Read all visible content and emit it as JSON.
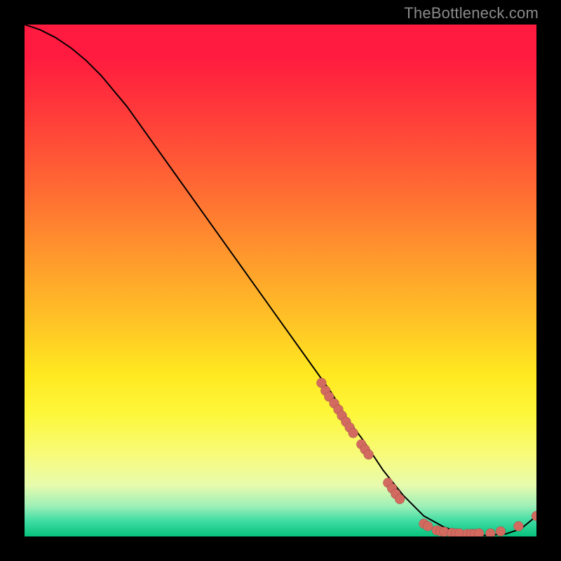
{
  "watermark": "TheBottleneck.com",
  "colors": {
    "point": "#d36a60",
    "curve": "#000000",
    "background": "#000000"
  },
  "chart_data": {
    "type": "line",
    "title": "",
    "xlabel": "",
    "ylabel": "",
    "xlim": [
      0,
      100
    ],
    "ylim": [
      0,
      100
    ],
    "grid": false,
    "legend": false,
    "curve": {
      "x": [
        0,
        3,
        6,
        9,
        12,
        15,
        20,
        25,
        30,
        35,
        40,
        45,
        50,
        55,
        60,
        63,
        66,
        70,
        74,
        78,
        82,
        86,
        90,
        94,
        97,
        100
      ],
      "y": [
        100,
        99,
        97.5,
        95.5,
        93,
        90,
        84,
        77,
        70,
        63,
        56,
        49,
        42,
        35,
        28,
        23,
        19,
        13,
        8,
        4,
        1.8,
        0.5,
        0.2,
        0.5,
        1.5,
        4
      ]
    },
    "points": [
      {
        "x": 58.0,
        "y": 30.0
      },
      {
        "x": 58.8,
        "y": 28.5
      },
      {
        "x": 59.5,
        "y": 27.3
      },
      {
        "x": 60.5,
        "y": 26.0
      },
      {
        "x": 61.3,
        "y": 24.8
      },
      {
        "x": 62.0,
        "y": 23.6
      },
      {
        "x": 62.8,
        "y": 22.4
      },
      {
        "x": 63.5,
        "y": 21.3
      },
      {
        "x": 64.2,
        "y": 20.2
      },
      {
        "x": 65.8,
        "y": 18.0
      },
      {
        "x": 66.5,
        "y": 17.0
      },
      {
        "x": 67.2,
        "y": 16.0
      },
      {
        "x": 71.0,
        "y": 10.5
      },
      {
        "x": 71.8,
        "y": 9.4
      },
      {
        "x": 72.5,
        "y": 8.3
      },
      {
        "x": 73.3,
        "y": 7.3
      },
      {
        "x": 78.0,
        "y": 2.5
      },
      {
        "x": 78.8,
        "y": 2.0
      },
      {
        "x": 80.5,
        "y": 1.2
      },
      {
        "x": 81.3,
        "y": 1.0
      },
      {
        "x": 82.0,
        "y": 0.9
      },
      {
        "x": 83.5,
        "y": 0.7
      },
      {
        "x": 84.3,
        "y": 0.6
      },
      {
        "x": 85.0,
        "y": 0.6
      },
      {
        "x": 86.5,
        "y": 0.5
      },
      {
        "x": 87.3,
        "y": 0.5
      },
      {
        "x": 88.0,
        "y": 0.5
      },
      {
        "x": 88.8,
        "y": 0.6
      },
      {
        "x": 91.0,
        "y": 0.6
      },
      {
        "x": 93.0,
        "y": 1.0
      },
      {
        "x": 96.5,
        "y": 2.0
      },
      {
        "x": 100.0,
        "y": 4.0
      }
    ]
  }
}
